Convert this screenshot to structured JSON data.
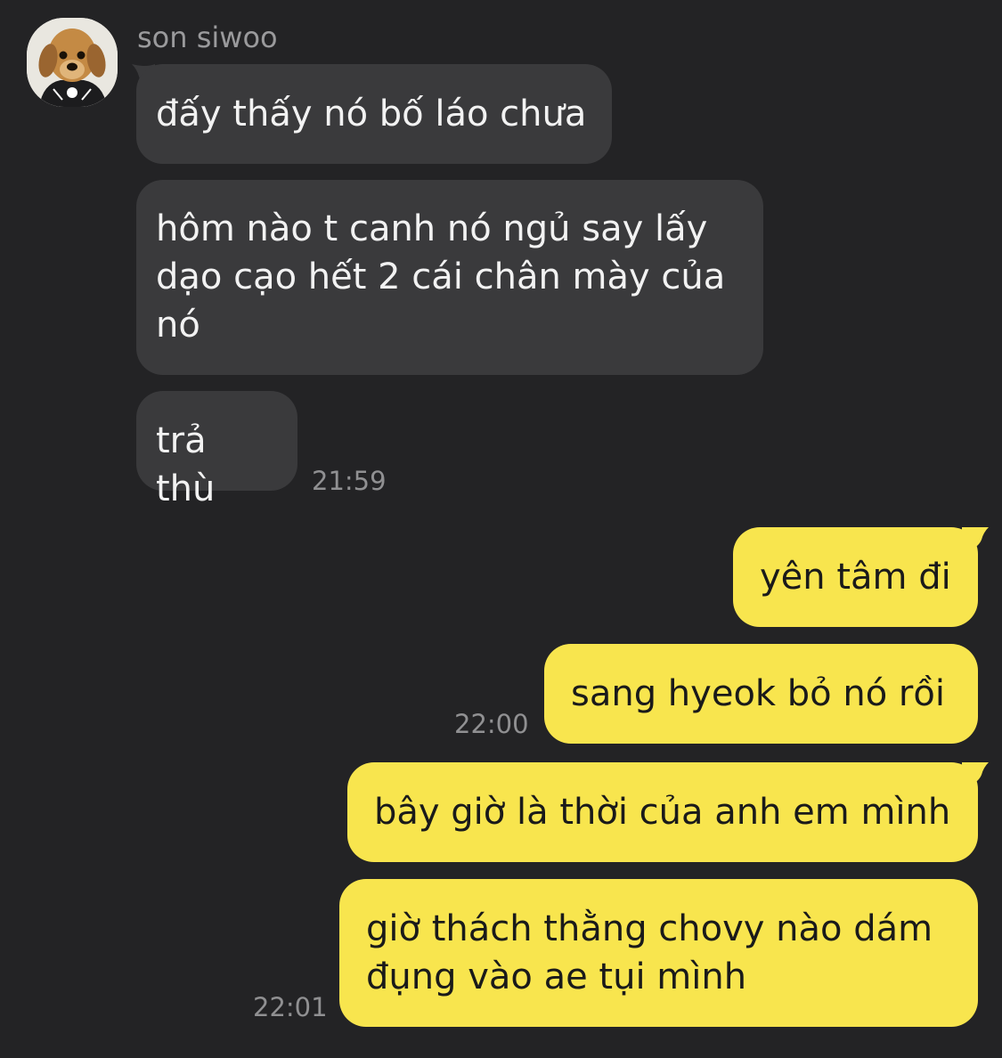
{
  "chat": {
    "contact_name": "son siwoo",
    "incoming": [
      {
        "text": "đấy thấy nó bố láo chưa"
      },
      {
        "text": "hôm nào t canh nó ngủ say lấy dạo cạo hết 2 cái chân mày của nó"
      },
      {
        "text": "trả thù"
      }
    ],
    "incoming_time": "21:59",
    "outgoing": [
      {
        "text": "yên tâm đi"
      },
      {
        "text": "sang hyeok bỏ nó rồi"
      },
      {
        "text": "bây giờ là thời của anh em mình"
      },
      {
        "text": "giờ thách thằng chovy nào dám đụng vào ae tụi mình"
      }
    ],
    "outgoing_times": [
      "22:00",
      "22:01"
    ]
  },
  "colors": {
    "background": "#232325",
    "incoming_bubble": "#3a3a3c",
    "outgoing_bubble": "#f8e54e"
  },
  "icons": {
    "avatar": "puppy-avatar"
  }
}
